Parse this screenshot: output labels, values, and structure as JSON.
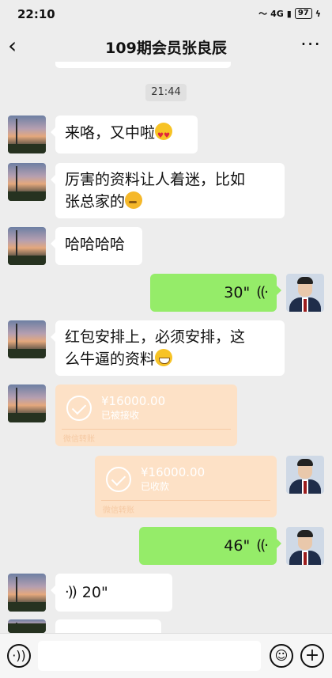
{
  "status": {
    "time": "22:10",
    "network": "4G",
    "battery": "97"
  },
  "header": {
    "title": "109期会员张良辰",
    "back_icon": "chevron-left-icon",
    "more_icon": "more-icon"
  },
  "divider_time": "21:44",
  "messages": [
    {
      "side": "left",
      "text": "来咯，又中啦",
      "emoji": "heart-eyes"
    },
    {
      "side": "left",
      "lines": [
        "厉害的资料让人着迷，比如",
        "张总家的"
      ],
      "emoji": "thinking"
    },
    {
      "side": "left",
      "text": "哈哈哈哈"
    },
    {
      "side": "right",
      "type": "voice",
      "duration": "30\""
    },
    {
      "side": "left",
      "lines": [
        "红包安排上，必须安排，这",
        "么牛逼的资料"
      ],
      "emoji": "grin"
    },
    {
      "side": "left",
      "type": "transfer",
      "amount": "¥16000.00",
      "status": "已被接收",
      "source": "微信转账"
    },
    {
      "side": "right",
      "type": "transfer",
      "amount": "¥16000.00",
      "status": "已收款",
      "source": "微信转账"
    },
    {
      "side": "right",
      "type": "voice",
      "duration": "46\""
    },
    {
      "side": "left",
      "type": "voice",
      "duration": "20\""
    }
  ],
  "input": {
    "voice_icon": "voice-icon",
    "emoji_icon": "emoji-icon",
    "plus_icon": "plus-icon"
  },
  "colors": {
    "bg": "#ededed",
    "sent": "#95ec69",
    "received": "#ffffff",
    "transfer": "#fde1c6"
  }
}
